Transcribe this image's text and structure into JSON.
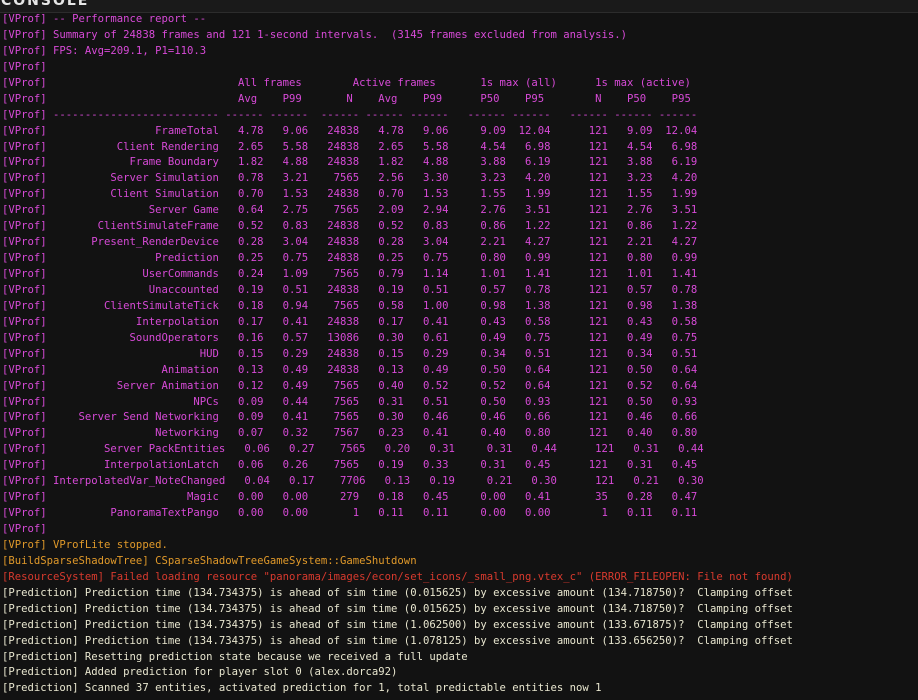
{
  "window": {
    "title": "CONSOLE"
  },
  "colors": {
    "background": "#121212",
    "vprof": "#d74ad7",
    "vprof_stopped": "#e0992a",
    "build_shadow_tree": "#e0992a",
    "error": "#d83a2e",
    "prediction": "#e8e6cf"
  },
  "console": {
    "lines": [
      {
        "cls": "prof",
        "text": "[VProf] -- Performance report --"
      },
      {
        "cls": "prof",
        "text": "[VProf] Summary of 24838 frames and 121 1-second intervals.  (3145 frames excluded from analysis.)"
      },
      {
        "cls": "prof",
        "text": "[VProf] FPS: Avg=209.1, P1=110.3"
      },
      {
        "cls": "prof",
        "text": "[VProf]"
      },
      {
        "cls": "prof",
        "text": "[VProf]                              All frames        Active frames       1s max (all)      1s max (active)"
      },
      {
        "cls": "prof",
        "text": "[VProf]                              Avg    P99       N    Avg    P99      P50    P95        N    P50    P95"
      },
      {
        "cls": "prof",
        "text": "[VProf] -------------------------- ------ ------  ------ ------ ------   ------ ------   ------ ------ ------"
      },
      {
        "cls": "prof",
        "text": "[VProf]                 FrameTotal   4.78   9.06   24838   4.78   9.06     9.09  12.04      121   9.09  12.04"
      },
      {
        "cls": "prof",
        "text": "[VProf]           Client Rendering   2.65   5.58   24838   2.65   5.58     4.54   6.98      121   4.54   6.98"
      },
      {
        "cls": "prof",
        "text": "[VProf]             Frame Boundary   1.82   4.88   24838   1.82   4.88     3.88   6.19      121   3.88   6.19"
      },
      {
        "cls": "prof",
        "text": "[VProf]          Server Simulation   0.78   3.21    7565   2.56   3.30     3.23   4.20      121   3.23   4.20"
      },
      {
        "cls": "prof",
        "text": "[VProf]          Client Simulation   0.70   1.53   24838   0.70   1.53     1.55   1.99      121   1.55   1.99"
      },
      {
        "cls": "prof",
        "text": "[VProf]                Server Game   0.64   2.75    7565   2.09   2.94     2.76   3.51      121   2.76   3.51"
      },
      {
        "cls": "prof",
        "text": "[VProf]        ClientSimulateFrame   0.52   0.83   24838   0.52   0.83     0.86   1.22      121   0.86   1.22"
      },
      {
        "cls": "prof",
        "text": "[VProf]       Present_RenderDevice   0.28   3.04   24838   0.28   3.04     2.21   4.27      121   2.21   4.27"
      },
      {
        "cls": "prof",
        "text": "[VProf]                 Prediction   0.25   0.75   24838   0.25   0.75     0.80   0.99      121   0.80   0.99"
      },
      {
        "cls": "prof",
        "text": "[VProf]               UserCommands   0.24   1.09    7565   0.79   1.14     1.01   1.41      121   1.01   1.41"
      },
      {
        "cls": "prof",
        "text": "[VProf]                Unaccounted   0.19   0.51   24838   0.19   0.51     0.57   0.78      121   0.57   0.78"
      },
      {
        "cls": "prof",
        "text": "[VProf]         ClientSimulateTick   0.18   0.94    7565   0.58   1.00     0.98   1.38      121   0.98   1.38"
      },
      {
        "cls": "prof",
        "text": "[VProf]              Interpolation   0.17   0.41   24838   0.17   0.41     0.43   0.58      121   0.43   0.58"
      },
      {
        "cls": "prof",
        "text": "[VProf]             SoundOperators   0.16   0.57   13086   0.30   0.61     0.49   0.75      121   0.49   0.75"
      },
      {
        "cls": "prof",
        "text": "[VProf]                        HUD   0.15   0.29   24838   0.15   0.29     0.34   0.51      121   0.34   0.51"
      },
      {
        "cls": "prof",
        "text": "[VProf]                  Animation   0.13   0.49   24838   0.13   0.49     0.50   0.64      121   0.50   0.64"
      },
      {
        "cls": "prof",
        "text": "[VProf]           Server Animation   0.12   0.49    7565   0.40   0.52     0.52   0.64      121   0.52   0.64"
      },
      {
        "cls": "prof",
        "text": "[VProf]                       NPCs   0.09   0.44    7565   0.31   0.51     0.50   0.93      121   0.50   0.93"
      },
      {
        "cls": "prof",
        "text": "[VProf]     Server Send Networking   0.09   0.41    7565   0.30   0.46     0.46   0.66      121   0.46   0.66"
      },
      {
        "cls": "prof",
        "text": "[VProf]                 Networking   0.07   0.32    7567   0.23   0.41     0.40   0.80      121   0.40   0.80"
      },
      {
        "cls": "prof",
        "text": "[VProf]         Server PackEntities   0.06   0.27    7565   0.20   0.31     0.31   0.44      121   0.31   0.44"
      },
      {
        "cls": "prof",
        "text": "[VProf]         InterpolationLatch   0.06   0.26    7565   0.19   0.33     0.31   0.45      121   0.31   0.45"
      },
      {
        "cls": "prof",
        "text": "[VProf] InterpolatedVar_NoteChanged   0.04   0.17    7706   0.13   0.19     0.21   0.30      121   0.21   0.30"
      },
      {
        "cls": "prof",
        "text": "[VProf]                      Magic   0.00   0.00     279   0.18   0.45     0.00   0.41       35   0.28   0.47"
      },
      {
        "cls": "prof",
        "text": "[VProf]          PanoramaTextPango   0.00   0.00       1   0.11   0.11     0.00   0.00        1   0.11   0.11"
      },
      {
        "cls": "prof",
        "text": "[VProf]"
      },
      {
        "cls": "vstop",
        "text": "[VProf] VProfLite stopped."
      },
      {
        "cls": "bsst",
        "text": "[BuildSparseShadowTree] CSparseShadowTreeGameSystem::GameShutdown"
      },
      {
        "cls": "err",
        "text": "[ResourceSystem] Failed loading resource \"panorama/images/econ/set_icons/_small_png.vtex_c\" (ERROR_FILEOPEN: File not found)"
      },
      {
        "cls": "pred",
        "text": "[Prediction] Prediction time (134.734375) is ahead of sim time (0.015625) by excessive amount (134.718750)?  Clamping offset"
      },
      {
        "cls": "pred",
        "text": "[Prediction] Prediction time (134.734375) is ahead of sim time (0.015625) by excessive amount (134.718750)?  Clamping offset"
      },
      {
        "cls": "pred",
        "text": "[Prediction] Prediction time (134.734375) is ahead of sim time (1.062500) by excessive amount (133.671875)?  Clamping offset"
      },
      {
        "cls": "pred",
        "text": "[Prediction] Prediction time (134.734375) is ahead of sim time (1.078125) by excessive amount (133.656250)?  Clamping offset"
      },
      {
        "cls": "pred",
        "text": "[Prediction] Resetting prediction state because we received a full update"
      },
      {
        "cls": "pred",
        "text": "[Prediction] Added prediction for player slot 0 (alex.dorca92)"
      },
      {
        "cls": "pred",
        "text": "[Prediction] Scanned 37 entities, activated prediction for 1, total predictable entities now 1"
      }
    ]
  }
}
